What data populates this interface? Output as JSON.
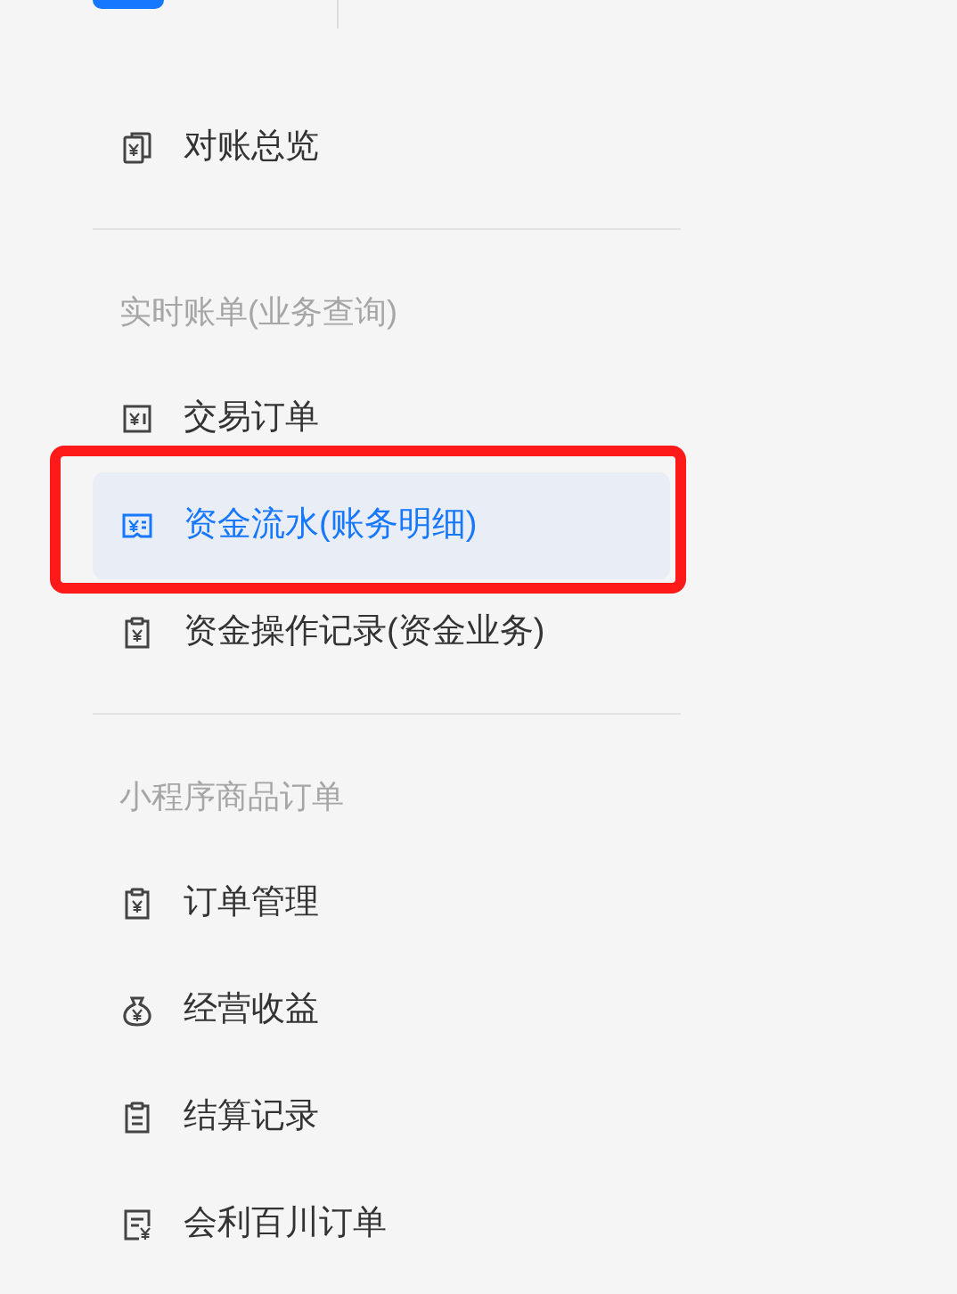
{
  "sections": [
    {
      "items": [
        {
          "label": "对账总览",
          "kind": "copies",
          "selected": false
        }
      ]
    },
    {
      "header": "实时账单(业务查询)",
      "items": [
        {
          "label": "交易订单",
          "kind": "bill",
          "selected": false
        },
        {
          "label": "资金流水(账务明细)",
          "kind": "receipt",
          "selected": true
        },
        {
          "label": "资金操作记录(资金业务)",
          "kind": "clipboard",
          "selected": false
        }
      ]
    },
    {
      "header": "小程序商品订单",
      "items": [
        {
          "label": "订单管理",
          "kind": "clipboard",
          "selected": false
        },
        {
          "label": "经营收益",
          "kind": "moneybag",
          "selected": false
        },
        {
          "label": "结算记录",
          "kind": "list",
          "selected": false
        },
        {
          "label": "会利百川订单",
          "kind": "document",
          "selected": false
        }
      ]
    }
  ]
}
